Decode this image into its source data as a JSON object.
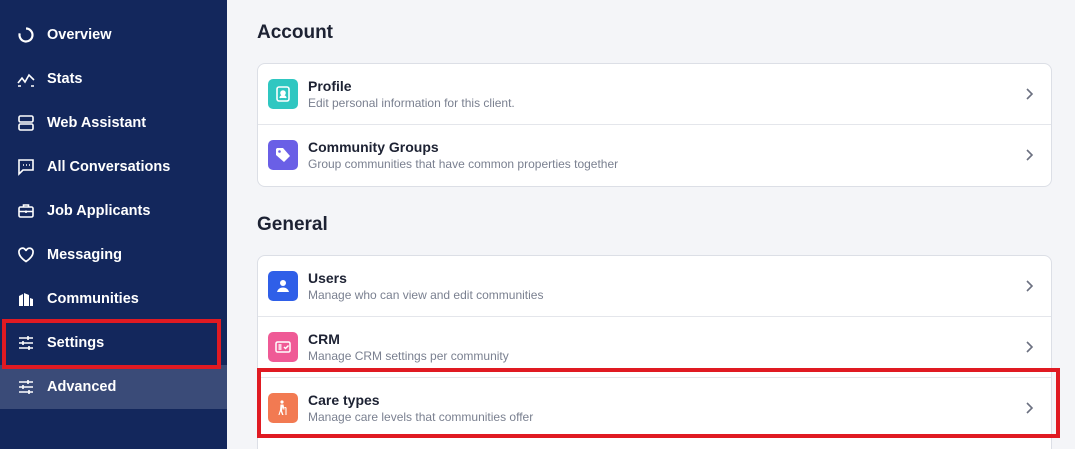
{
  "sidebar": {
    "items": [
      {
        "label": "Overview",
        "icon": "overview-icon"
      },
      {
        "label": "Stats",
        "icon": "stats-icon"
      },
      {
        "label": "Web Assistant",
        "icon": "web-assistant-icon"
      },
      {
        "label": "All Conversations",
        "icon": "conversations-icon"
      },
      {
        "label": "Job Applicants",
        "icon": "briefcase-icon"
      },
      {
        "label": "Messaging",
        "icon": "heart-icon"
      },
      {
        "label": "Communities",
        "icon": "buildings-icon"
      },
      {
        "label": "Settings",
        "icon": "sliders-icon"
      },
      {
        "label": "Advanced",
        "icon": "sliders-icon"
      }
    ],
    "active": "Advanced"
  },
  "sections": [
    {
      "title": "Account",
      "rows": [
        {
          "title": "Profile",
          "subtitle": "Edit personal information for this client.",
          "icon": "profile-icon",
          "color": "#2fc7c1"
        },
        {
          "title": "Community Groups",
          "subtitle": "Group communities that have common properties together",
          "icon": "tag-icon",
          "color": "#6a5fe6"
        }
      ]
    },
    {
      "title": "General",
      "rows": [
        {
          "title": "Users",
          "subtitle": "Manage who can view and edit communities",
          "icon": "user-icon",
          "color": "#2f5fe8"
        },
        {
          "title": "CRM",
          "subtitle": "Manage CRM settings per community",
          "icon": "crm-icon",
          "color": "#ef5a96"
        },
        {
          "title": "Care types",
          "subtitle": "Manage care levels that communities offer",
          "icon": "walking-cane-icon",
          "color": "#f27a52"
        }
      ]
    }
  ],
  "colors": {
    "sidebar_bg": "#13275c",
    "sidebar_active": "#3a4b78",
    "annotation_red": "#e01a22"
  }
}
